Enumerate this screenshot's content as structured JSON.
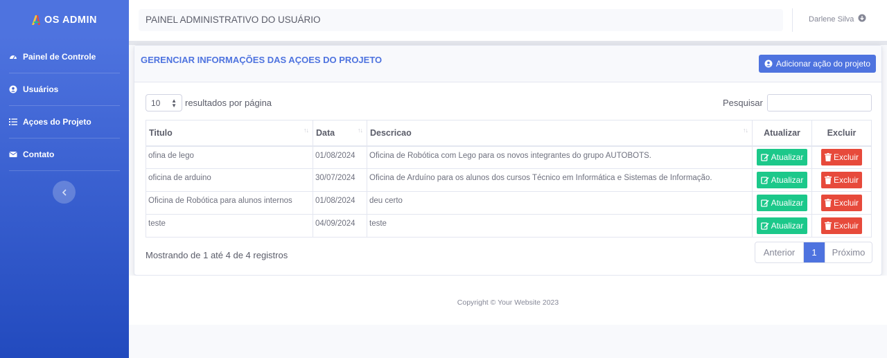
{
  "brand": {
    "name": "OS ADMIN",
    "logo_icon": "logo-icon"
  },
  "sidebar": {
    "items": [
      {
        "label": "Painel de Controle",
        "icon": "dashboard-icon"
      },
      {
        "label": "Usuários",
        "icon": "user-circle-icon"
      },
      {
        "label": "Açoes do Projeto",
        "icon": "list-icon"
      },
      {
        "label": "Contato",
        "icon": "envelope-icon"
      }
    ],
    "toggle_icon": "chevron-left-icon"
  },
  "topbar": {
    "title": "PAINEL ADMINISTRATIVO DO USUÁRIO",
    "user_name": "Darlene Silva",
    "user_icon": "arrow-down-circle-icon"
  },
  "card": {
    "title": "GERENCIAR INFORMAÇÕES DAS AÇOES DO PROJETO",
    "add_button": "Adicionar ação do projeto",
    "page_length": "10",
    "page_length_label": "resultados por página",
    "search_label": "Pesquisar",
    "search_value": ""
  },
  "table": {
    "columns": [
      "Titulo",
      "Data",
      "Descricao",
      "Atualizar",
      "Excluir"
    ],
    "rows": [
      {
        "titulo": "ofina de lego",
        "data": "01/08/2024",
        "descricao": "Oficina de Robótica com Lego para os novos integrantes do grupo AUTOBOTS."
      },
      {
        "titulo": "oficina de arduino",
        "data": "30/07/2024",
        "descricao": "Oficina de Arduíno para os alunos dos cursos Técnico em Informática e Sistemas de Informação."
      },
      {
        "titulo": "Oficina de Robótica para alunos internos",
        "data": "01/08/2024",
        "descricao": "deu certo"
      },
      {
        "titulo": "teste",
        "data": "04/09/2024",
        "descricao": "teste"
      }
    ],
    "update_label": "Atualizar",
    "delete_label": "Excluir"
  },
  "pagination": {
    "info": "Mostrando de 1 até 4 de 4 registros",
    "prev": "Anterior",
    "current": "1",
    "next": "Próximo"
  },
  "footer": {
    "copyright": "Copyright © Your Website 2023"
  },
  "colors": {
    "primary": "#4e73df",
    "success": "#1cc88a",
    "danger": "#e74a3b"
  }
}
